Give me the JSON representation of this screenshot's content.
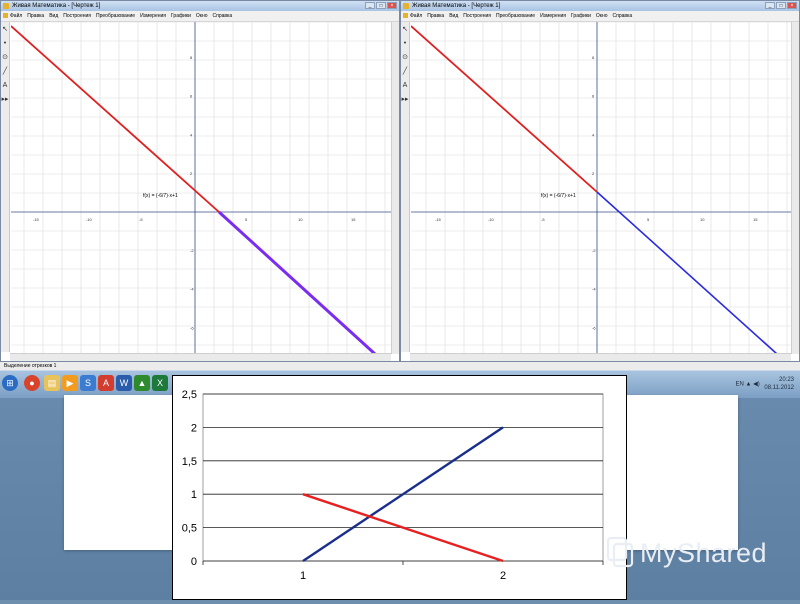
{
  "left_window": {
    "title": "Живая Математика - [Чертеж 1]",
    "menu": [
      "Файл",
      "Правка",
      "Вид",
      "Построения",
      "Преобразование",
      "Измерения",
      "Графики",
      "Окно",
      "Справка"
    ],
    "formula": "f(x) = (-6/7)·x+1"
  },
  "right_window": {
    "title": "Живая Математика - [Чертеж 1]",
    "menu": [
      "Файл",
      "Правка",
      "Вид",
      "Построения",
      "Преобразование",
      "Измерения",
      "Графики",
      "Окно",
      "Справка"
    ],
    "formula": "f(x) = (-6/7)·x+1"
  },
  "graph_axes": {
    "x_ticks": [
      "-15",
      "-10",
      "-5",
      "5",
      "10",
      "15"
    ],
    "y_ticks": [
      "8",
      "6",
      "4",
      "2",
      "-2",
      "-4",
      "-6"
    ]
  },
  "toolbar_icons": [
    "arrow-tool-icon",
    "point-tool-icon",
    "compass-tool-icon",
    "line-tool-icon",
    "text-tool-icon",
    "custom-tool-icon"
  ],
  "status_text": "Выделение отрезков 1",
  "taskbar": {
    "language": "EN",
    "time": "20:23",
    "date": "08.11.2012"
  },
  "colors": {
    "red_line": "#e02020",
    "purple_line": "#7a2cf0",
    "blue_line": "#2a2ae0",
    "navy_line": "#1a2e8c",
    "chart_red": "#e82020"
  },
  "chart_data": {
    "type": "line",
    "categories": [
      "1",
      "2"
    ],
    "series": [
      {
        "values": [
          0,
          2
        ],
        "color": "#1a2e8c"
      },
      {
        "values": [
          1,
          0
        ],
        "color": "#e82020"
      }
    ],
    "y_ticks": [
      "0",
      "0,5",
      "1",
      "1,5",
      "2",
      "2,5"
    ],
    "ylim": [
      0,
      2.5
    ],
    "grid": true
  },
  "logo": "MyShared"
}
